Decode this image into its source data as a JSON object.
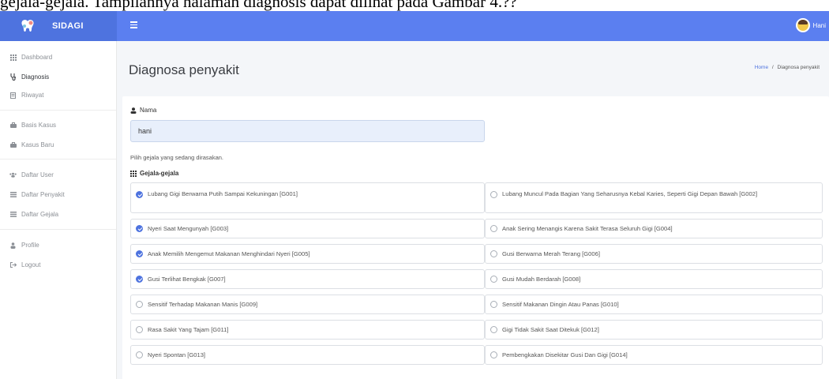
{
  "caption": "gejala-gejala. Tampilannya halaman diagnosis dapat dilihat pada Gambar 4.??",
  "brand": {
    "name": "SIDAGI"
  },
  "topbar": {
    "user_name": "Hani"
  },
  "sidebar": {
    "items": [
      {
        "label": "Dashboard",
        "icon": "grid-icon"
      },
      {
        "label": "Diagnosis",
        "icon": "stethoscope-icon"
      },
      {
        "label": "Riwayat",
        "icon": "book-icon"
      },
      {
        "label": "Basis Kasus",
        "icon": "briefcase-icon"
      },
      {
        "label": "Kasus Baru",
        "icon": "briefcase-icon"
      },
      {
        "label": "Daftar User",
        "icon": "users-icon"
      },
      {
        "label": "Daftar Penyakit",
        "icon": "list-icon"
      },
      {
        "label": "Daftar Gejala",
        "icon": "list-icon"
      },
      {
        "label": "Profile",
        "icon": "user-icon"
      },
      {
        "label": "Logout",
        "icon": "logout-icon"
      }
    ]
  },
  "page": {
    "title": "Diagnosa penyakit",
    "breadcrumb_home": "Home",
    "breadcrumb_sep": "/",
    "breadcrumb_current": "Diagnosa penyakit"
  },
  "form": {
    "name_label": "Nama",
    "name_value": "hani",
    "hint": "Pilih gejala yang sedang dirasakan.",
    "symptoms_label": "Gejala-gejala"
  },
  "symptoms": [
    {
      "label": "Lubang Gigi Berwarna Putih Sampai Kekuningan [G001]",
      "checked": true
    },
    {
      "label": "Lubang Muncul Pada Bagian Yang Seharusnya Kebal Karies, Seperti Gigi Depan Bawah [G002]",
      "checked": false
    },
    {
      "label": "Nyeri Saat Mengunyah [G003]",
      "checked": true
    },
    {
      "label": "Anak Sering Menangis Karena Sakit Terasa Seluruh Gigi [G004]",
      "checked": false
    },
    {
      "label": "Anak Memilih Mengemut Makanan Menghindari Nyeri [G005]",
      "checked": true
    },
    {
      "label": "Gusi Berwarna Merah Terang [G006]",
      "checked": false
    },
    {
      "label": "Gusi Terlihat Bengkak [G007]",
      "checked": true
    },
    {
      "label": "Gusi Mudah Berdarah [G008]",
      "checked": false
    },
    {
      "label": "Sensitif Terhadap Makanan Manis [G009]",
      "checked": false
    },
    {
      "label": "Sensitif Makanan Dingin Atau Panas [G010]",
      "checked": false
    },
    {
      "label": "Rasa Sakit Yang Tajam [G011]",
      "checked": false
    },
    {
      "label": "Gigi Tidak Sakit Saat Ditekuk [G012]",
      "checked": false
    },
    {
      "label": "Nyeri Spontan [G013]",
      "checked": false
    },
    {
      "label": "Pembengkakan Disekitar Gusi Dan Gigi [G014]",
      "checked": false
    }
  ]
}
